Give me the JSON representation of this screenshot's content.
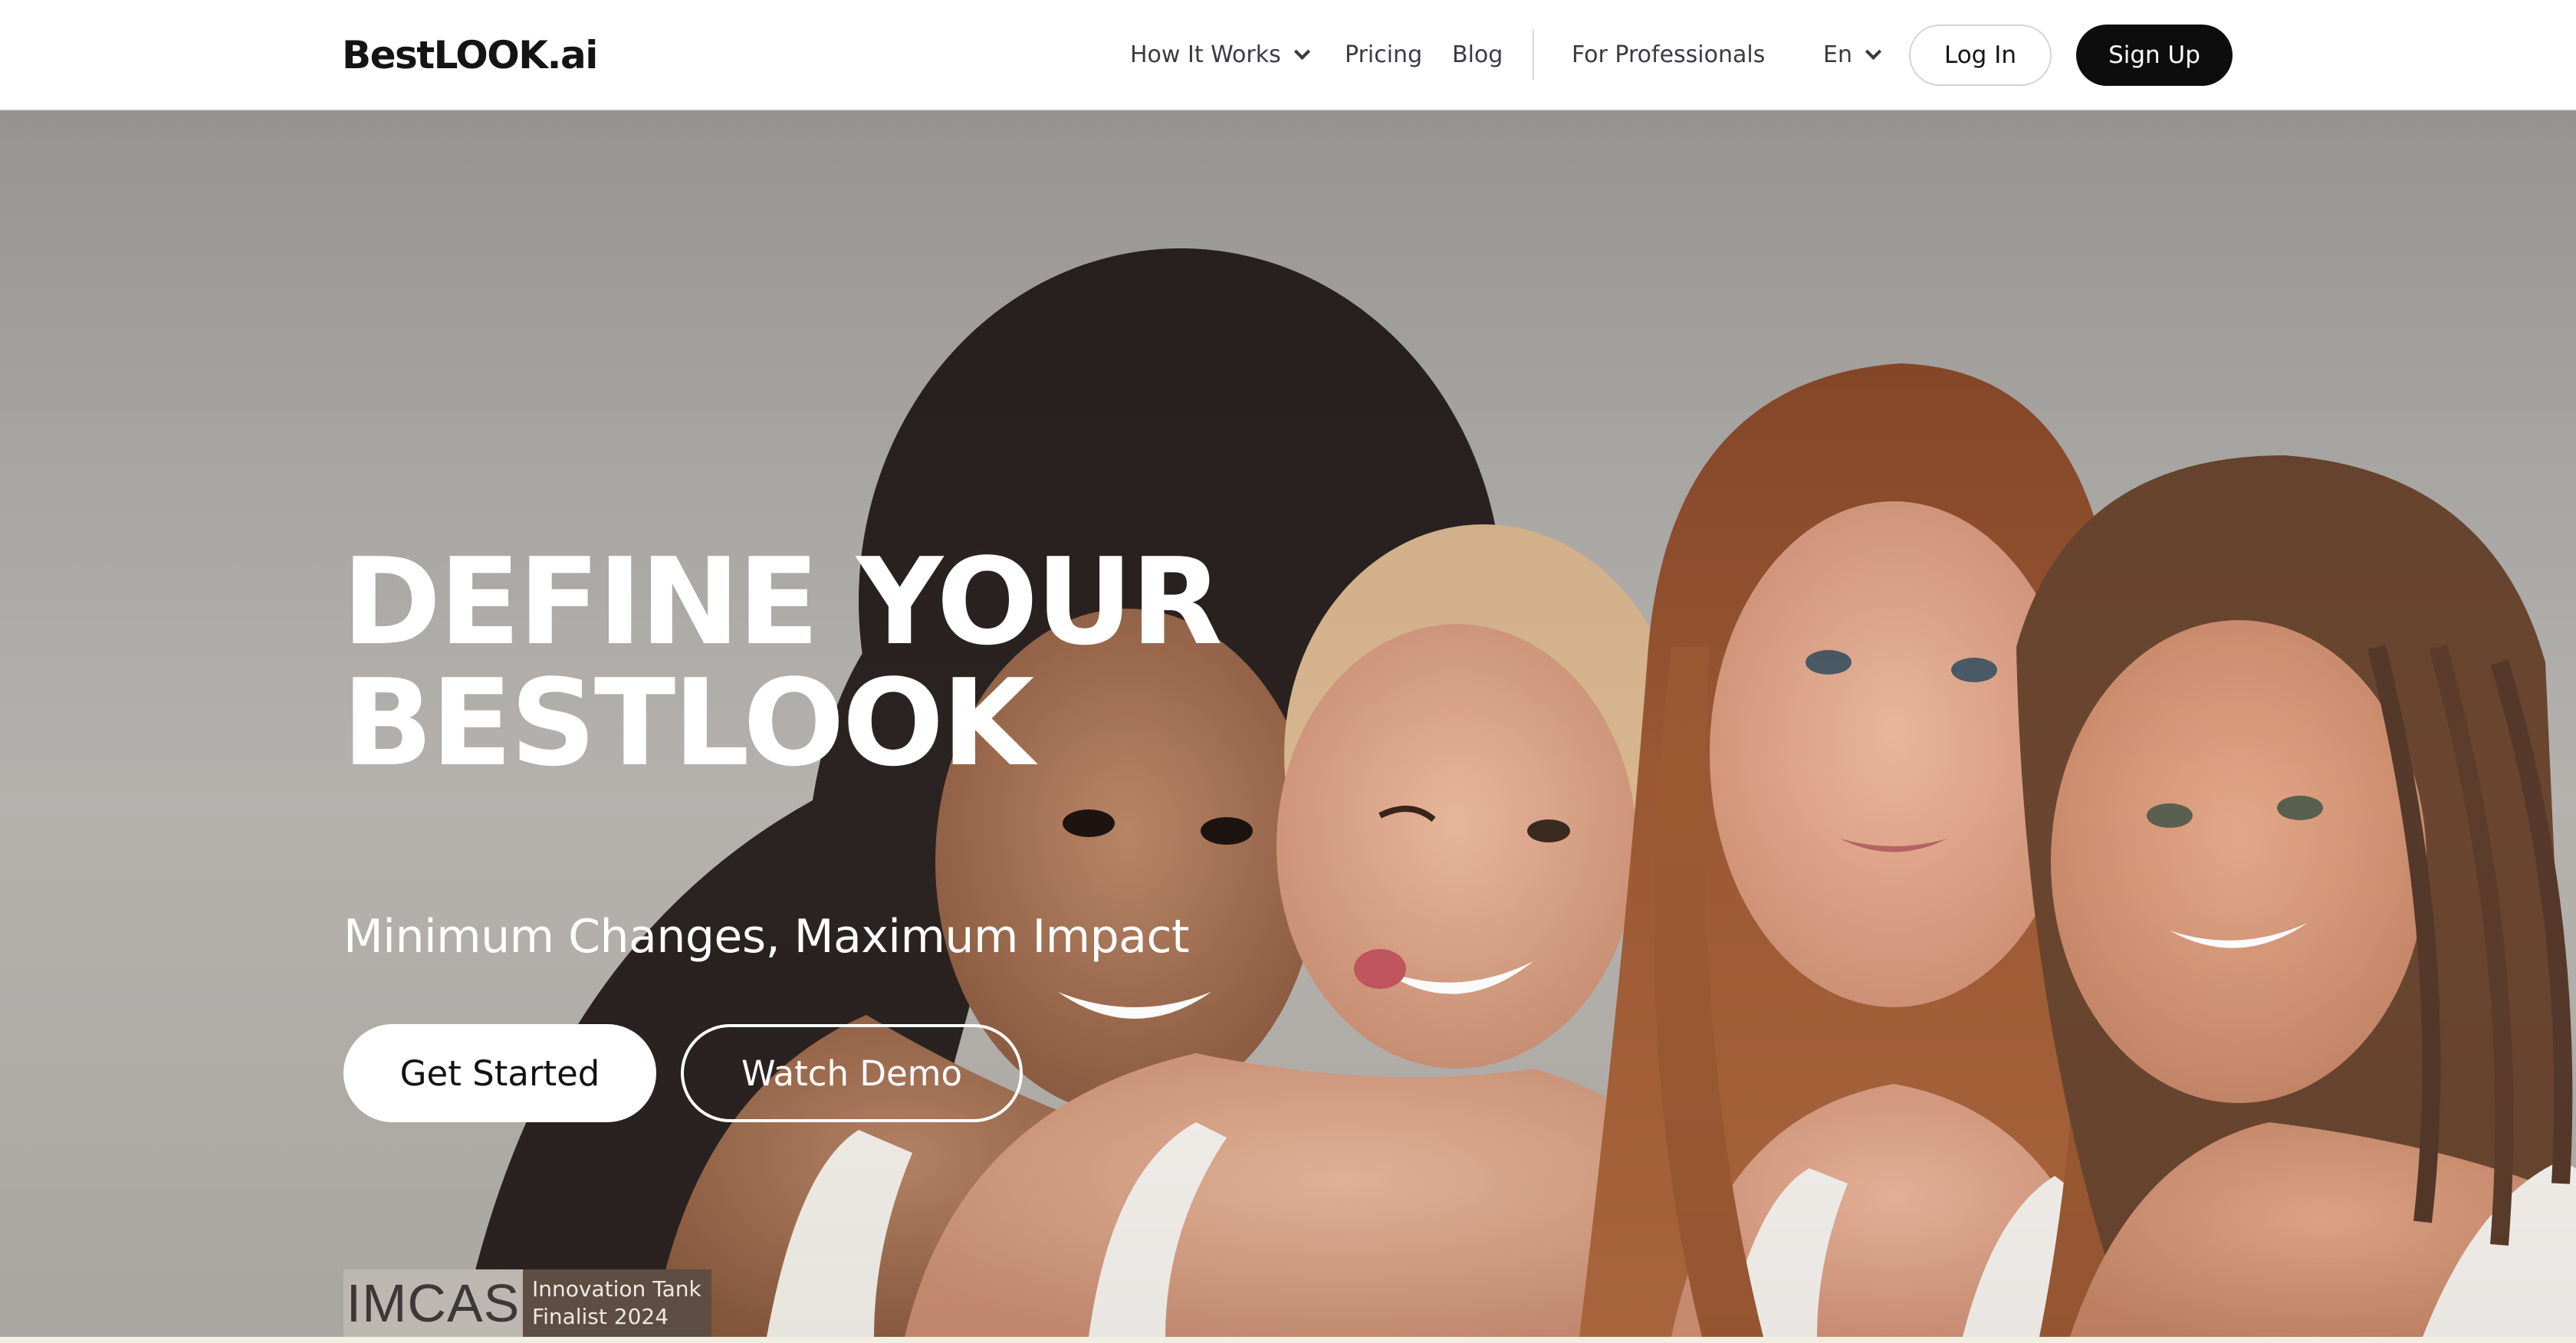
{
  "brand": {
    "logo": "BestLOOK.ai"
  },
  "nav": {
    "how_it_works": "How It Works",
    "pricing": "Pricing",
    "blog": "Blog",
    "professionals": "For Professionals",
    "language": "En",
    "login": "Log In",
    "signup": "Sign Up"
  },
  "hero": {
    "title_line1": "DEFINE YOUR",
    "title_line2": "BESTLOOK",
    "subtitle": "Minimum Changes, Maximum Impact",
    "cta_primary": "Get Started",
    "cta_secondary": "Watch Demo"
  },
  "badge": {
    "org": "IMCAS",
    "line1": "Innovation Tank",
    "line2": "Finalist 2024"
  },
  "icons": [
    "chevron-down-icon"
  ],
  "colors": {
    "navbar_bg": "#ffffff",
    "signup_bg": "#0d0d0d",
    "hero_text": "#ffffff",
    "badge_left": "#bdb7b2",
    "badge_right": "#5d4d42"
  }
}
